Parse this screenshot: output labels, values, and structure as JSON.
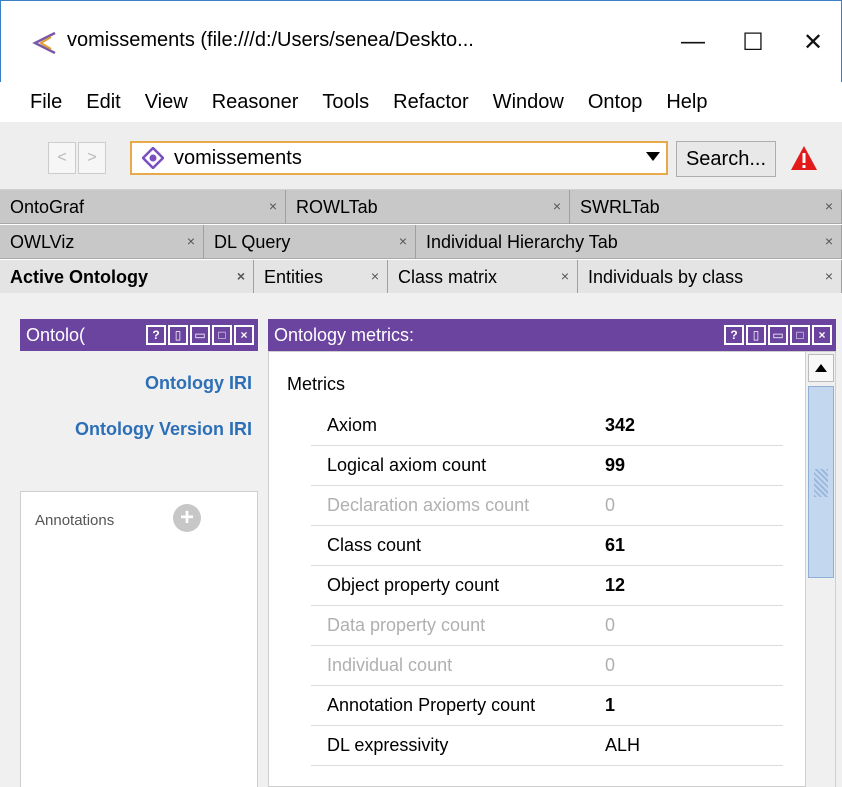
{
  "window": {
    "title": "vomissements (file:///d:/Users/senea/Deskto...",
    "min_symbol": "—",
    "max_symbol": "☐",
    "close_symbol": "✕"
  },
  "menu": {
    "items": [
      "File",
      "Edit",
      "View",
      "Reasoner",
      "Tools",
      "Refactor",
      "Window",
      "Ontop",
      "Help"
    ]
  },
  "toolbar": {
    "back_symbol": "<",
    "forward_symbol": ">",
    "ontology": "vomissements",
    "search_label": "Search...",
    "warning_color": "#e21a1a"
  },
  "tabs": {
    "row1": [
      {
        "label": "OntoGraf"
      },
      {
        "label": "ROWLTab"
      },
      {
        "label": "SWRLTab"
      }
    ],
    "row2": [
      {
        "label": "OWLViz"
      },
      {
        "label": "DL Query"
      },
      {
        "label": "Individual Hierarchy Tab"
      }
    ],
    "row3": [
      {
        "label": "Active Ontology"
      },
      {
        "label": "Entities"
      },
      {
        "label": "Class matrix"
      },
      {
        "label": "Individuals by class"
      }
    ],
    "close_symbol": "×"
  },
  "left_view": {
    "title": "Ontolo(",
    "iri_label": "Ontology IRI",
    "version_iri_label": "Ontology Version IRI",
    "annotations_label": "Annotations",
    "add_symbol": "+"
  },
  "right_view": {
    "title": "Ontology metrics:",
    "metrics_heading": "Metrics",
    "metrics": [
      {
        "name": "Axiom",
        "value": "342",
        "enabled": true
      },
      {
        "name": "Logical axiom count",
        "value": "99",
        "enabled": true
      },
      {
        "name": "Declaration axioms count",
        "value": "0",
        "enabled": false
      },
      {
        "name": "Class count",
        "value": "61",
        "enabled": true
      },
      {
        "name": "Object property count",
        "value": "12",
        "enabled": true
      },
      {
        "name": "Data property count",
        "value": "0",
        "enabled": false
      },
      {
        "name": "Individual count",
        "value": "0",
        "enabled": false
      },
      {
        "name": "Annotation Property count",
        "value": "1",
        "enabled": true
      },
      {
        "name": "DL expressivity",
        "value": "ALH",
        "enabled": true
      }
    ]
  },
  "view_buttons": [
    "?",
    "▯",
    "▭",
    "□",
    "×"
  ],
  "colors": {
    "view_header": "#6b44a0",
    "link_blue": "#2d6fb6",
    "combo_border": "#e8a94a"
  }
}
